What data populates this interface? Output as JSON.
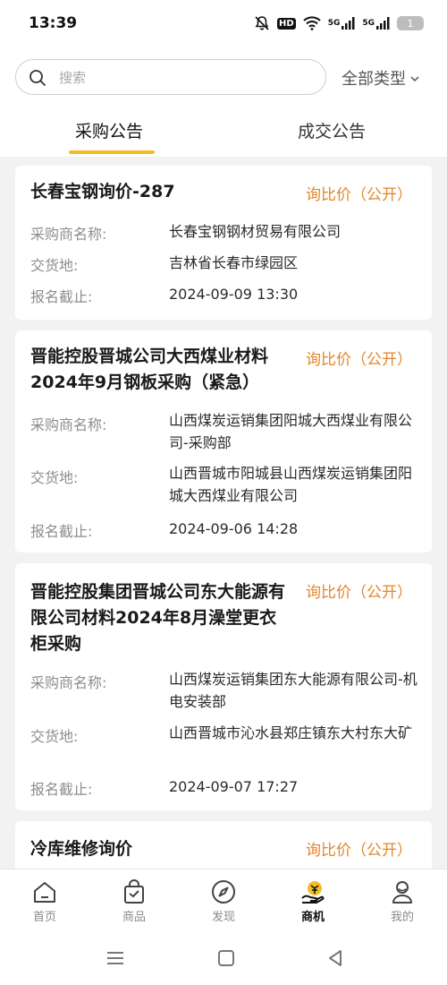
{
  "status_bar": {
    "time": "13:39",
    "hd_label": "HD",
    "net1": "5G",
    "net2": "5G",
    "battery": "1",
    "icons": [
      "mute-bell-icon",
      "hd-call-icon",
      "wifi-icon",
      "signal-5g-icon",
      "signal-5g-icon",
      "battery-icon"
    ]
  },
  "search": {
    "placeholder": "搜索"
  },
  "filter": {
    "label": "全部类型"
  },
  "tabs": [
    {
      "label": "采购公告",
      "active": true
    },
    {
      "label": "成交公告",
      "active": false
    }
  ],
  "colors": {
    "accent": "#f3bd24",
    "tag": "#e2862c",
    "label": "#8d8d8d",
    "bg": "#f2f2f2"
  },
  "cards": [
    {
      "title": "长春宝钢询价-287",
      "tag": "询比价（公开）",
      "buyer_label": "采购商名称:",
      "buyer": "长春宝钢钢材贸易有限公司",
      "place_label": "交货地:",
      "place": "吉林省长春市绿园区",
      "deadline_label": "报名截止:",
      "deadline": "2024-09-09 13:30"
    },
    {
      "title": "晋能控股晋城公司大西煤业材料2024年9月钢板采购（紧急）",
      "tag": "询比价（公开）",
      "buyer_label": "采购商名称:",
      "buyer": "山西煤炭运销集团阳城大西煤业有限公司-采购部",
      "place_label": "交货地:",
      "place": "山西晋城市阳城县山西煤炭运销集团阳城大西煤业有限公司",
      "deadline_label": "报名截止:",
      "deadline": "2024-09-06 14:28"
    },
    {
      "title": "晋能控股集团晋城公司东大能源有限公司材料2024年8月澡堂更衣柜采购",
      "tag": "询比价（公开）",
      "buyer_label": "采购商名称:",
      "buyer": "山西煤炭运销集团东大能源有限公司-机电安装部",
      "place_label": "交货地:",
      "place": "山西晋城市沁水县郑庄镇东大村东大矿",
      "deadline_label": "报名截止:",
      "deadline": "2024-09-07 17:27"
    },
    {
      "title": "冷库维修询价",
      "tag": "询比价（公开）"
    }
  ],
  "bottom_nav": [
    {
      "label": "首页",
      "icon": "home-icon",
      "active": false
    },
    {
      "label": "商品",
      "icon": "shopping-bag-icon",
      "active": false
    },
    {
      "label": "发现",
      "icon": "compass-icon",
      "active": false
    },
    {
      "label": "商机",
      "icon": "business-opportunity-icon",
      "active": true
    },
    {
      "label": "我的",
      "icon": "profile-icon",
      "active": false
    }
  ],
  "system_nav": [
    "menu-icon",
    "home-square-icon",
    "back-triangle-icon"
  ]
}
